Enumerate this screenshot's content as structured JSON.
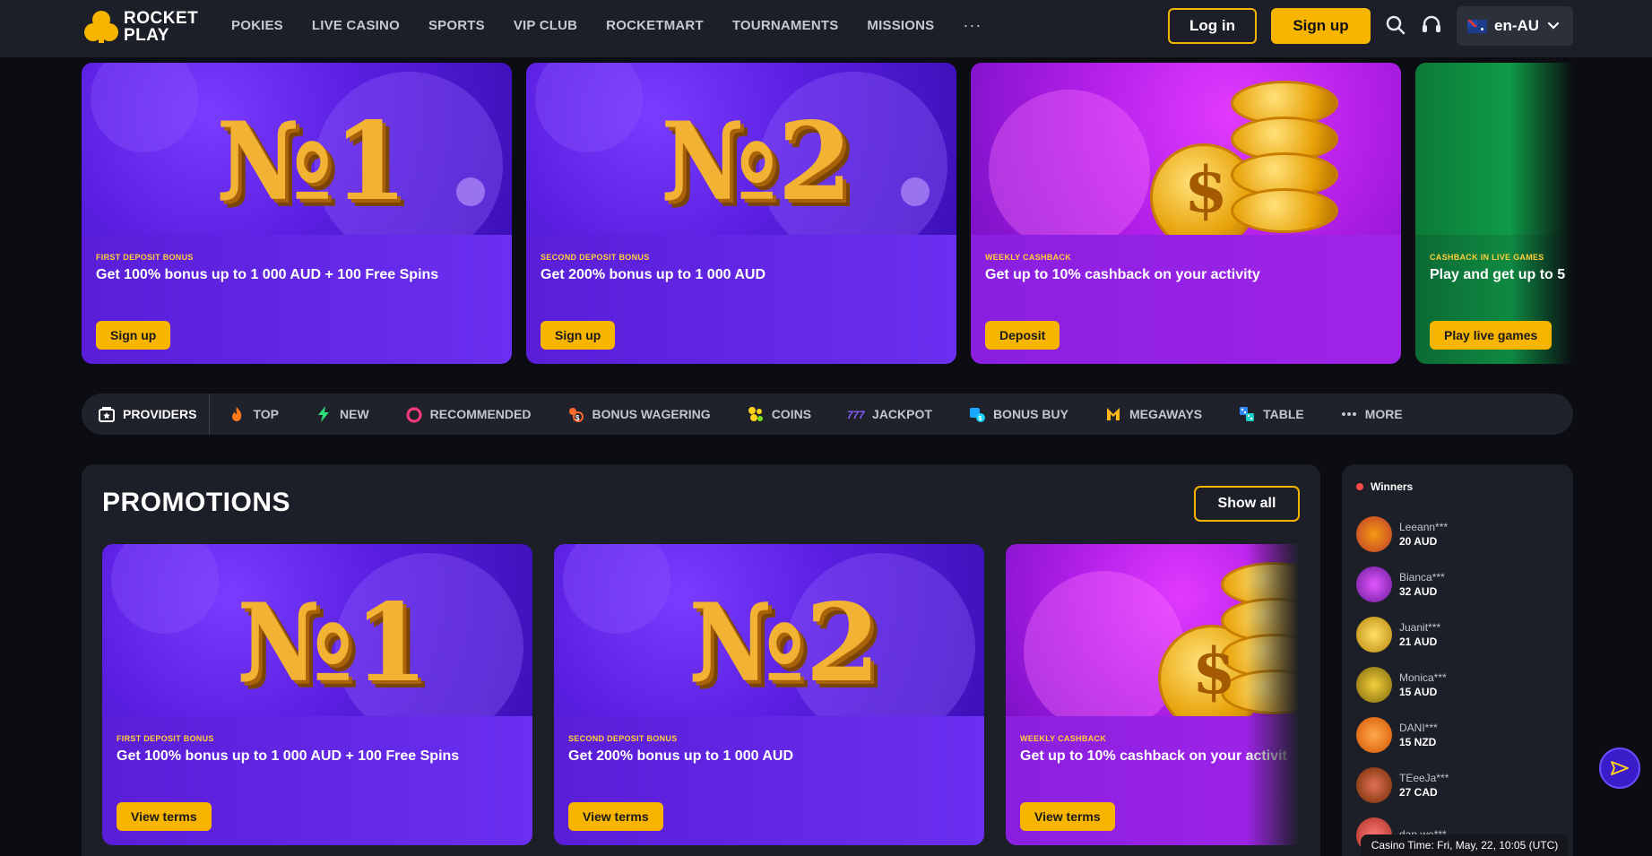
{
  "brand": {
    "name_line1": "ROCKET",
    "name_line2": "PLAY",
    "accent": "#f7b500"
  },
  "nav": {
    "items": [
      "POKIES",
      "LIVE CASINO",
      "SPORTS",
      "VIP CLUB",
      "ROCKETMART",
      "TOURNAMENTS",
      "MISSIONS"
    ],
    "more": "···"
  },
  "header": {
    "login_label": "Log in",
    "signup_label": "Sign up",
    "language": "en-AU",
    "icons": [
      "search-icon",
      "headset-icon",
      "flag-au-icon",
      "chevron-down-icon"
    ]
  },
  "banners": [
    {
      "tag": "FIRST DEPOSIT BONUS",
      "headline": "Get 100% bonus up to 1 000 AUD + 100 Free Spins",
      "cta": "Sign up",
      "art_label": "№1"
    },
    {
      "tag": "SECOND DEPOSIT BONUS",
      "headline": "Get 200% bonus up to 1 000 AUD",
      "cta": "Sign up",
      "art_label": "№2"
    },
    {
      "tag": "WEEKLY CASHBACK",
      "headline": "Get up to 10% cashback on your activity",
      "cta": "Deposit",
      "art_label": "$"
    },
    {
      "tag": "CASHBACK IN LIVE GAMES",
      "headline": "Play and get up to 5",
      "cta": "Play live games"
    }
  ],
  "categories": [
    {
      "label": "PROVIDERS",
      "icon": "providers-icon"
    },
    {
      "label": "TOP",
      "icon": "flame-icon"
    },
    {
      "label": "NEW",
      "icon": "lightning-icon"
    },
    {
      "label": "RECOMMENDED",
      "icon": "ring-icon"
    },
    {
      "label": "BONUS WAGERING",
      "icon": "bonus-wagering-icon"
    },
    {
      "label": "COINS",
      "icon": "coins-icon"
    },
    {
      "label": "JACKPOT",
      "icon": "jackpot-icon"
    },
    {
      "label": "BONUS BUY",
      "icon": "bonus-buy-icon"
    },
    {
      "label": "MEGAWAYS",
      "icon": "megaways-icon"
    },
    {
      "label": "TABLE",
      "icon": "table-icon"
    },
    {
      "label": "MORE",
      "icon": "more-dots-icon"
    }
  ],
  "promotions": {
    "title": "PROMOTIONS",
    "show_all": "Show all",
    "cards": [
      {
        "tag": "FIRST DEPOSIT BONUS",
        "headline": "Get 100% bonus up to 1 000 AUD + 100 Free Spins",
        "cta": "View terms",
        "art_label": "№1"
      },
      {
        "tag": "SECOND DEPOSIT BONUS",
        "headline": "Get 200% bonus up to 1 000 AUD",
        "cta": "View terms",
        "art_label": "№2"
      },
      {
        "tag": "WEEKLY CASHBACK",
        "headline": "Get up to 10% cashback on your activit",
        "cta": "View terms",
        "art_label": "$"
      }
    ]
  },
  "winners": {
    "title": "Winners",
    "list": [
      {
        "name": "Leeann***",
        "amount": "20 AUD",
        "color": "#c0392b"
      },
      {
        "name": "Bianca***",
        "amount": "32 AUD",
        "color": "#8e44ad"
      },
      {
        "name": "Juanit***",
        "amount": "21 AUD",
        "color": "#d4a017"
      },
      {
        "name": "Monica***",
        "amount": "15 AUD",
        "color": "#b8860b"
      },
      {
        "name": "DANI***",
        "amount": "15 NZD",
        "color": "#e67e22"
      },
      {
        "name": "TEeeJa***",
        "amount": "27 CAD",
        "color": "#a0522d"
      },
      {
        "name": "dan.we***",
        "amount": "",
        "color": "#c0392b"
      }
    ]
  },
  "footer": {
    "casino_time": "Casino Time: Fri, May, 22, 10:05 (UTC)"
  }
}
